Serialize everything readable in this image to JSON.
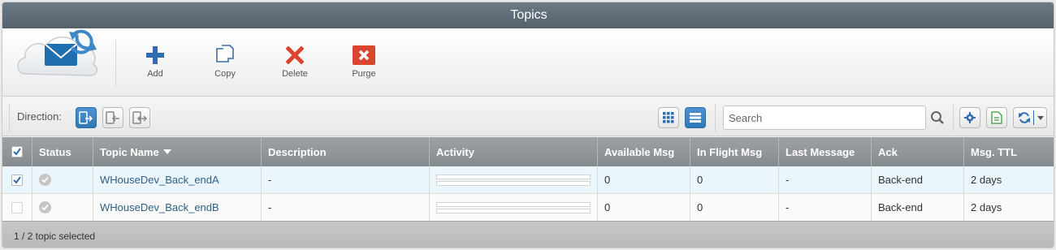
{
  "window": {
    "title": "Topics"
  },
  "toolbar": {
    "add_label": "Add",
    "copy_label": "Copy",
    "delete_label": "Delete",
    "purge_label": "Purge"
  },
  "filters": {
    "direction_label": "Direction:",
    "search_placeholder": "Search",
    "active_view": "list"
  },
  "colors": {
    "titlebar": "#5f6c77",
    "add": "#2f6db0",
    "delete": "#d9452f",
    "purge": "#d9452f",
    "link": "#2e5f82",
    "selected_row": "#eaf5fc"
  },
  "table": {
    "columns": [
      "Status",
      "Topic Name",
      "Description",
      "Activity",
      "Available Msg",
      "In Flight Msg",
      "Last Message",
      "Ack",
      "Msg. TTL"
    ],
    "sort_column": "Topic Name",
    "sort_direction": "descending",
    "rows": [
      {
        "checked": true,
        "status_icon": "check-circle-icon",
        "name": "WHouseDev_Back_endA",
        "description": "-",
        "available": "0",
        "in_flight": "0",
        "last_message": "-",
        "ack": "Back-end",
        "ttl": "2 days"
      },
      {
        "checked": false,
        "status_icon": "check-circle-icon",
        "name": "WHouseDev_Back_endB",
        "description": "-",
        "available": "0",
        "in_flight": "0",
        "last_message": "-",
        "ack": "Back-end",
        "ttl": "2 days"
      }
    ]
  },
  "footer": {
    "selection_text": "1 / 2 topic selected"
  }
}
